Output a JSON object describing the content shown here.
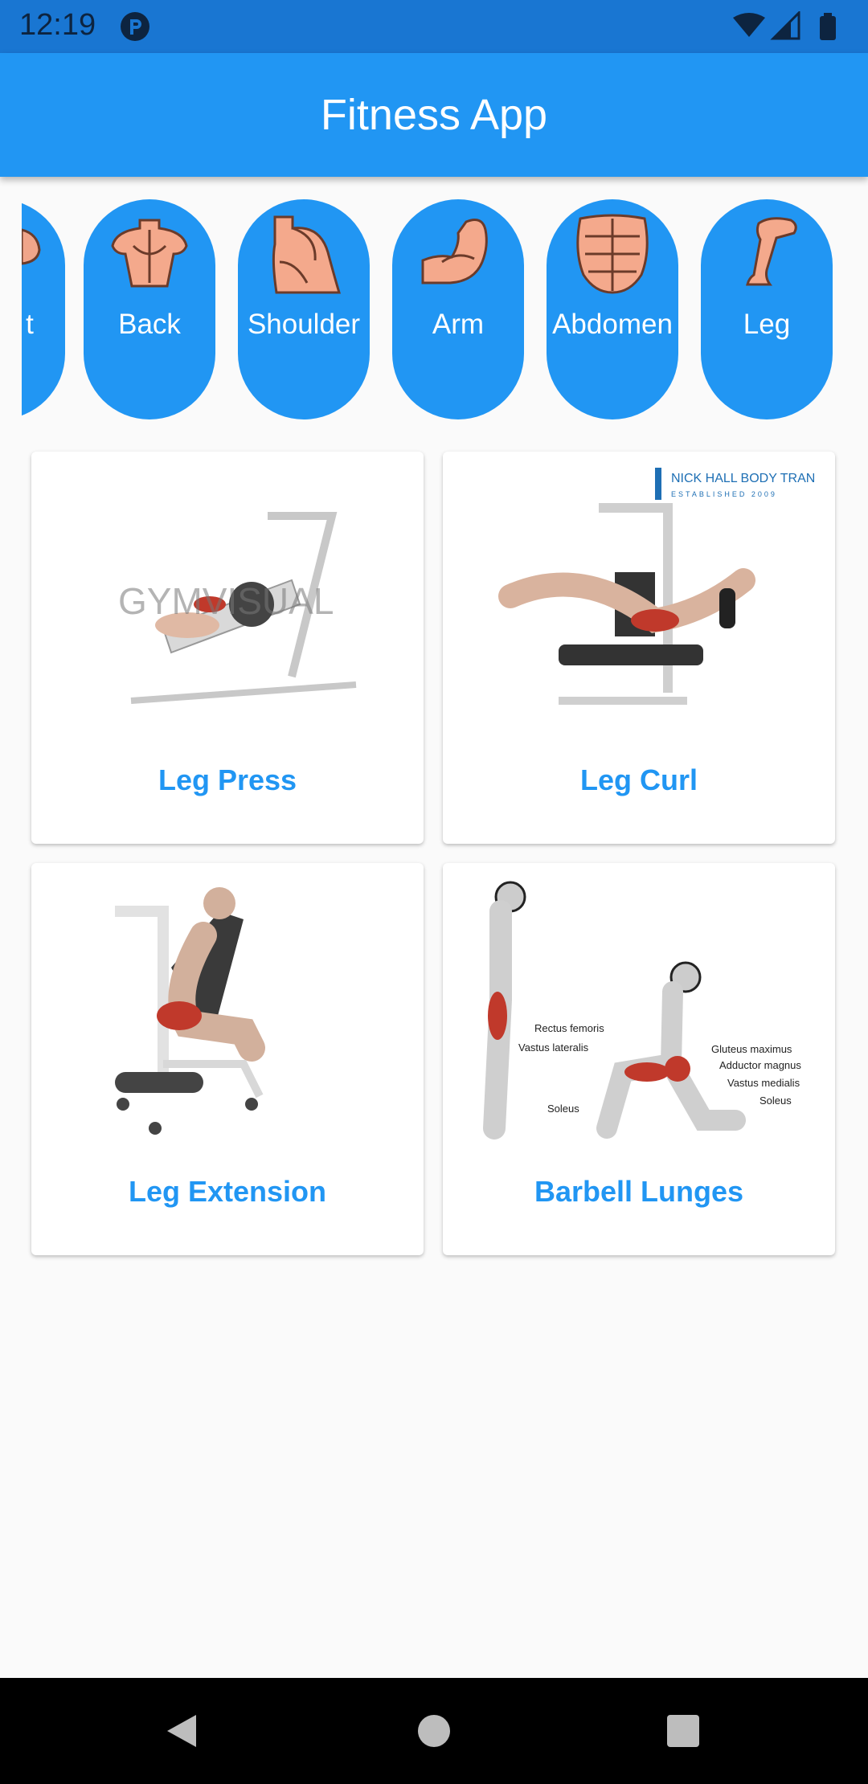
{
  "status_bar": {
    "time": "12:19"
  },
  "app_bar": {
    "title": "Fitness App"
  },
  "categories": [
    {
      "label": "t",
      "icon": "chest-icon"
    },
    {
      "label": "Back",
      "icon": "back-muscle-icon"
    },
    {
      "label": "Shoulder",
      "icon": "shoulder-icon"
    },
    {
      "label": "Arm",
      "icon": "arm-biceps-icon"
    },
    {
      "label": "Abdomen",
      "icon": "abdomen-icon"
    },
    {
      "label": "Leg",
      "icon": "leg-icon"
    }
  ],
  "exercises": [
    {
      "title": "Leg Press",
      "watermark": "GYMVISUAL"
    },
    {
      "title": "Leg Curl",
      "watermark": "NICK HALL BODY TRANSFORMATIONS",
      "watermark_sub": "ESTABLISHED 2009"
    },
    {
      "title": "Leg Extension"
    },
    {
      "title": "Barbell Lunges",
      "annotations": [
        "Rectus femoris",
        "Vastus lateralis",
        "Gluteus maximus",
        "Adductor magnus",
        "Vastus medialis",
        "Soleus",
        "Soleus"
      ]
    }
  ],
  "colors": {
    "primary": "#2196f3",
    "status_bar": "#1976d2",
    "muscle": "#c0392b"
  }
}
